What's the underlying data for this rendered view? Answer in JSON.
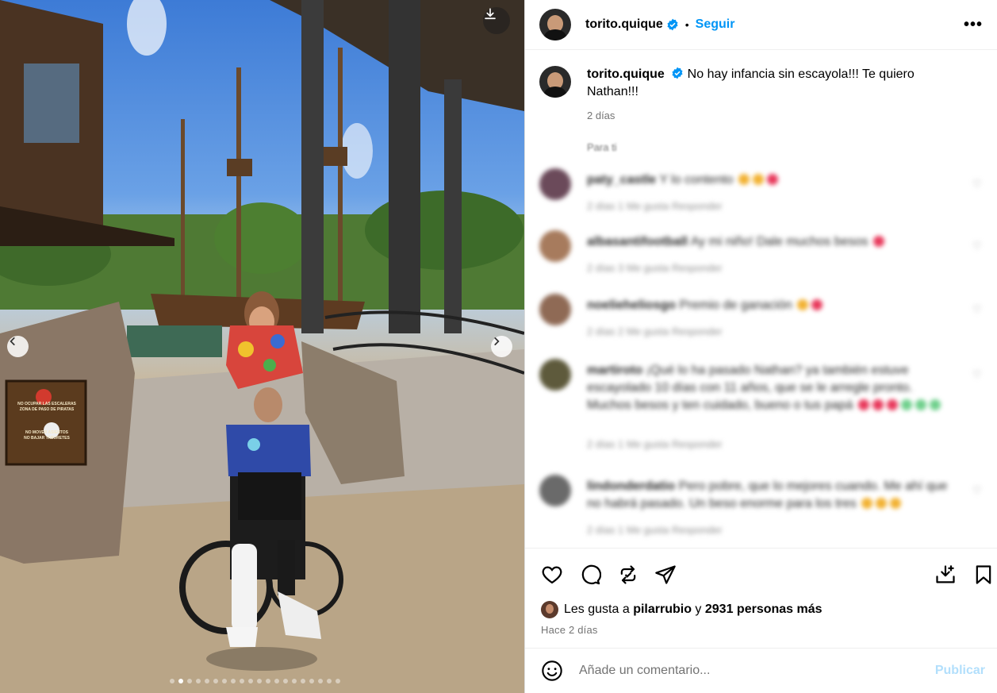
{
  "post": {
    "username": "torito.quique",
    "follow_label": "Seguir",
    "separator": "•",
    "more_label": "•••",
    "caption_text": "No hay infancia sin escayola!!! Te quiero Nathan!!!",
    "caption_time": "2 días",
    "section_hint": "Para ti",
    "icons": [
      "download-icon",
      "chevron-left-icon",
      "chevron-right-icon",
      "verified-badge-icon",
      "more-options-icon",
      "heart-icon",
      "comment-icon",
      "repost-icon",
      "share-icon",
      "save-icon",
      "emoji-icon"
    ],
    "carousel": {
      "slides": 20,
      "active_index": 1
    }
  },
  "comments": [
    {
      "author": "paty_castle",
      "text": "Y lo contento",
      "meta": "2 días   1 Me gusta   Responder"
    },
    {
      "author": "albasantifootball",
      "text": "Ay mi niño! Dale muchos besos",
      "meta": "2 días   3 Me gusta   Responder"
    },
    {
      "author": "noelieheliosgo",
      "text": "Premio de ganación",
      "meta": "2 días   2 Me gusta   Responder"
    },
    {
      "author": "martiroto",
      "text": "¡Qué lo ha pasado Nathan? ya también estuve escayolado 10 días con 11 años, que se le arregle pronto. Muchos besos y ten cuidado, bueno o tus papá",
      "meta": "2 días   1 Me gusta   Responder"
    },
    {
      "author": "lindonderdatio",
      "text": "Pero pobre, que lo mejores cuando. Me ahí que no habrá pasado. Un beso enorme para los tres",
      "meta": "2 días   1 Me gusta   Responder"
    }
  ],
  "actions": {
    "likes_prefix": "Les gusta a",
    "liked_by": "pilarrubio",
    "likes_joiner": "y",
    "likes_rest": "2931 personas más",
    "time_ago": "Hace 2 días"
  },
  "compose": {
    "placeholder": "Añade un comentario...",
    "publish_label": "Publicar"
  },
  "photo": {
    "sign_lines": [
      "NO OCUPAR LAS ESCALERAS",
      "ZONA DE PASO DE PIRATAS",
      "NO MOVER ASIENTOS",
      "NO BAJAR TABURETES"
    ]
  },
  "colors": {
    "accent": "#0095f6",
    "publish_disabled": "#b2dffc",
    "secondary_text": "#737373"
  }
}
